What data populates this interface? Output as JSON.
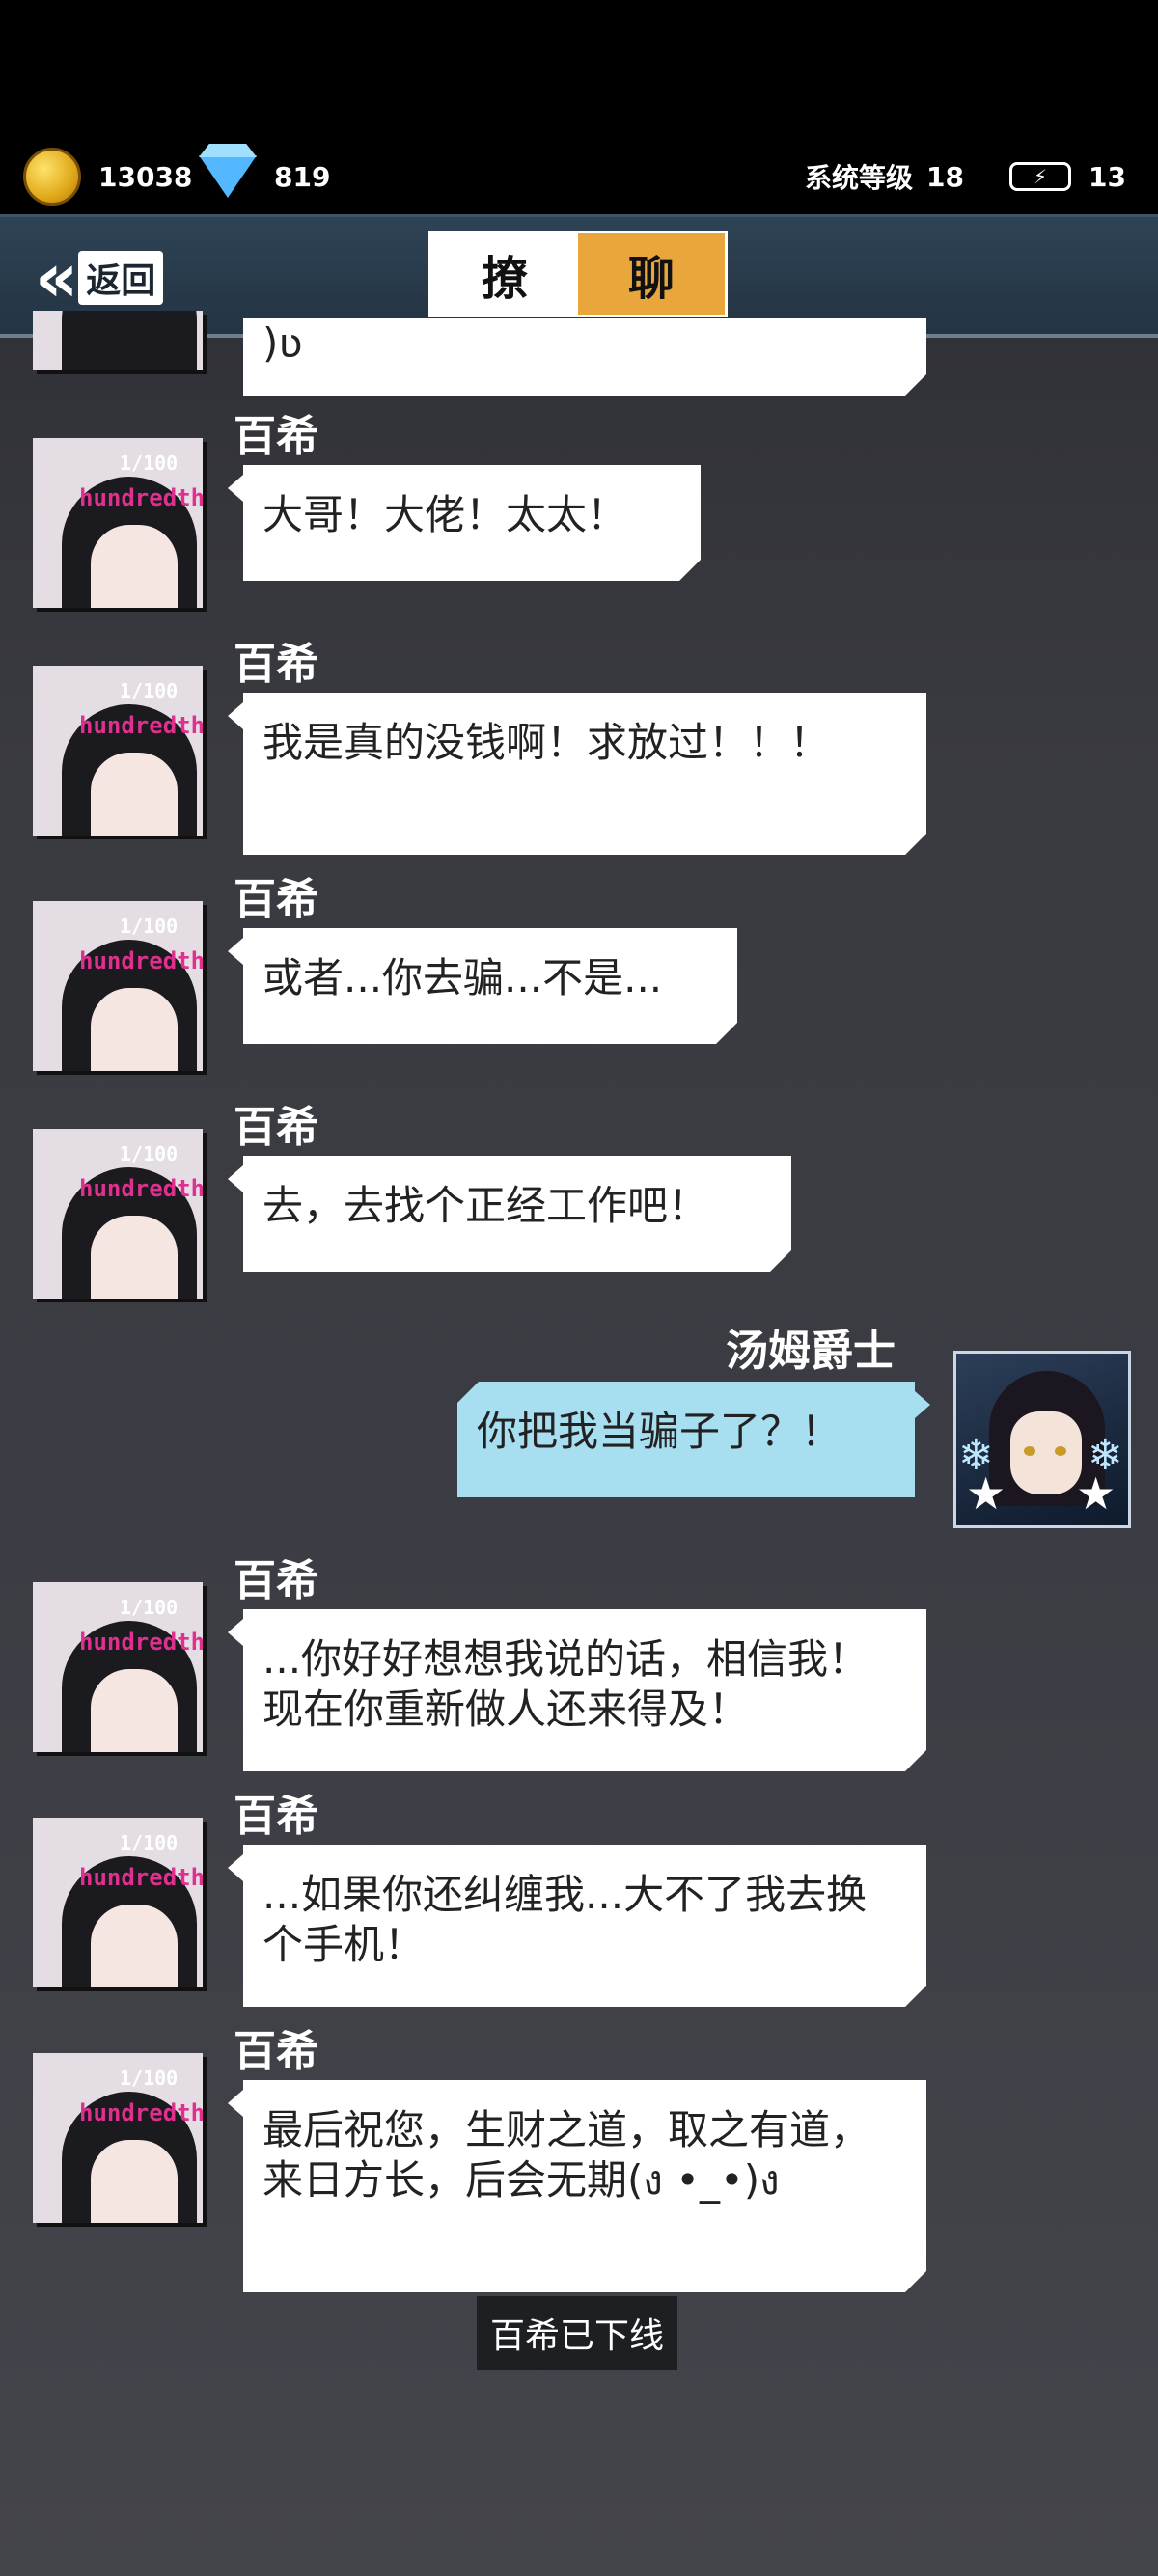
{
  "currency": {
    "coins": "13038",
    "gems": "819"
  },
  "system": {
    "level_label": "系统等级",
    "level": "18",
    "energy_icon": "⚡",
    "energy": "13"
  },
  "header": {
    "back_label": "返回",
    "tab1": "撩",
    "tab2": "聊"
  },
  "messages": [
    {
      "sender": "",
      "text": ")ʋ"
    },
    {
      "sender": "百希",
      "text": "大哥！大佬！太太！"
    },
    {
      "sender": "百希",
      "text": "我是真的没钱啊！求放过！！！"
    },
    {
      "sender": "百希",
      "text": "或者...你去骗...不是..."
    },
    {
      "sender": "百希",
      "text": "去，去找个正经工作吧！"
    },
    {
      "sender": "汤姆爵士",
      "text": "你把我当骗子了？！"
    },
    {
      "sender": "百希",
      "text": "...你好好想想我说的话，相信我！现在你重新做人还来得及！"
    },
    {
      "sender": "百希",
      "text": "...如果你还纠缠我...大不了我去换个手机！"
    },
    {
      "sender": "百希",
      "text": "最后祝您，生财之道，取之有道，来日方长，后会无期(ง •_•)ง"
    }
  ],
  "avatar": {
    "line1": "hundredth",
    "line2": "1/100"
  },
  "status_notice": "百希已下线",
  "colors": {
    "accent": "#e9a63c",
    "header": "#2f4356",
    "my_bubble": "#a7dff1",
    "other_bubble": "#ffffff"
  }
}
